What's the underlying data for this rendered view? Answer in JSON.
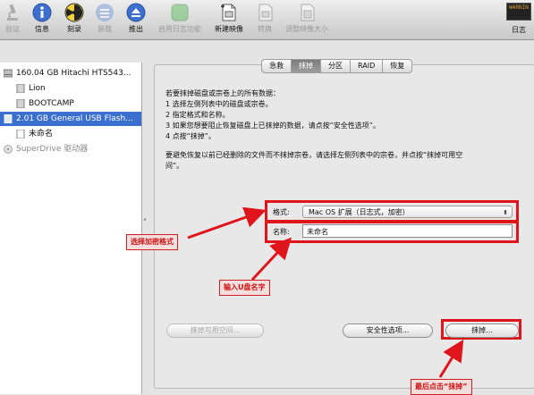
{
  "toolbar": {
    "buttons": [
      {
        "label": "验证",
        "icon": "microscope-icon",
        "enabled": false
      },
      {
        "label": "信息",
        "icon": "info-icon",
        "enabled": true
      },
      {
        "label": "刻录",
        "icon": "burn-icon",
        "enabled": true
      },
      {
        "label": "装载",
        "icon": "mount-icon",
        "enabled": false
      },
      {
        "label": "推出",
        "icon": "eject-icon",
        "enabled": true
      },
      {
        "label": "启用日志功能",
        "icon": "journal-icon",
        "enabled": false
      },
      {
        "label": "新建映像",
        "icon": "new-image-icon",
        "enabled": true
      },
      {
        "label": "转换",
        "icon": "convert-icon",
        "enabled": false
      },
      {
        "label": "调整映像大小",
        "icon": "resize-image-icon",
        "enabled": false
      }
    ],
    "log": {
      "label": "日志",
      "icon_text": "WARNIN"
    }
  },
  "sidebar": {
    "items": [
      {
        "label": "160.04 GB Hitachi HTS543...",
        "type": "disk",
        "selected": false
      },
      {
        "label": "Lion",
        "type": "volume",
        "selected": false
      },
      {
        "label": "BOOTCAMP",
        "type": "volume",
        "selected": false
      },
      {
        "label": "2.01 GB General USB Flash...",
        "type": "usb-disk",
        "selected": true
      },
      {
        "label": "未命名",
        "type": "volume",
        "selected": false
      },
      {
        "label": "SuperDrive 驱动器",
        "type": "optical",
        "selected": false
      }
    ]
  },
  "tabs": [
    {
      "label": "急救",
      "active": false
    },
    {
      "label": "抹掉",
      "active": true
    },
    {
      "label": "分区",
      "active": false
    },
    {
      "label": "RAID",
      "active": false
    },
    {
      "label": "恢复",
      "active": false
    }
  ],
  "instructions": {
    "lines": [
      "若要抹掉磁盘或宗卷上的所有数据：",
      "1  选择左侧列表中的磁盘或宗卷。",
      "2  指定格式和名称。",
      "3  如果您想要阻止恢复磁盘上已抹掉的数据，请点按“安全性选项”。",
      "4  点按“抹掉”。"
    ],
    "note_lines": [
      "要避免恢复以前已经删除的文件而不抹掉宗卷，请选择左侧列表中的宗卷，并点按“抹掉可用空",
      "间”。"
    ]
  },
  "form": {
    "format_label": "格式:",
    "format_value": "Mac OS 扩展（日志式，加密）",
    "name_label": "名称:",
    "name_value": "未命名"
  },
  "buttons": {
    "erase_free_space": "抹掉可用空间...",
    "security_options": "安全性选项...",
    "erase": "抹掉..."
  },
  "annotations": {
    "select_format": "选择加密格式",
    "enter_name": "输入U盘名字",
    "click_erase": "最后点击“抹掉”"
  },
  "colors": {
    "selection": "#3a6fd0",
    "annotation_red": "#e0151b"
  }
}
